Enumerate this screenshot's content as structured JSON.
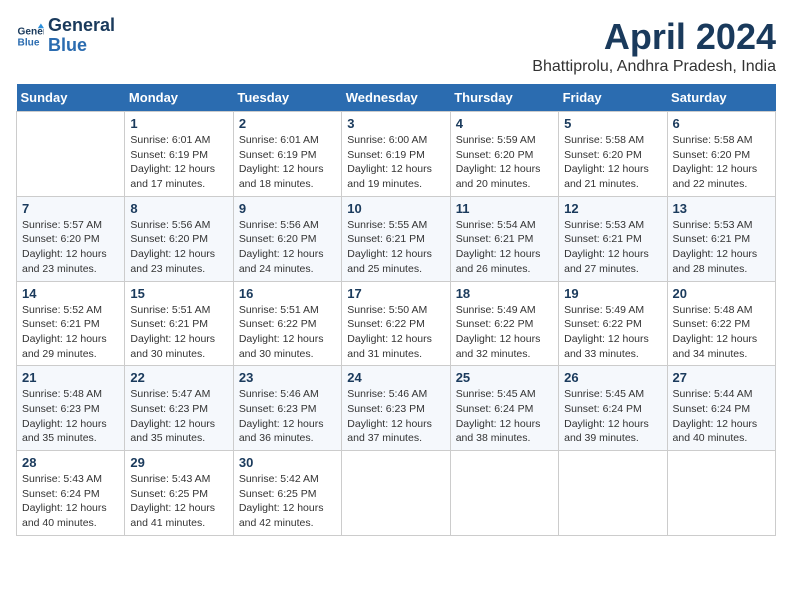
{
  "header": {
    "logo_line1": "General",
    "logo_line2": "Blue",
    "month": "April 2024",
    "location": "Bhattiprolu, Andhra Pradesh, India"
  },
  "days_of_week": [
    "Sunday",
    "Monday",
    "Tuesday",
    "Wednesday",
    "Thursday",
    "Friday",
    "Saturday"
  ],
  "weeks": [
    [
      {
        "day": "",
        "info": ""
      },
      {
        "day": "1",
        "info": "Sunrise: 6:01 AM\nSunset: 6:19 PM\nDaylight: 12 hours\nand 17 minutes."
      },
      {
        "day": "2",
        "info": "Sunrise: 6:01 AM\nSunset: 6:19 PM\nDaylight: 12 hours\nand 18 minutes."
      },
      {
        "day": "3",
        "info": "Sunrise: 6:00 AM\nSunset: 6:19 PM\nDaylight: 12 hours\nand 19 minutes."
      },
      {
        "day": "4",
        "info": "Sunrise: 5:59 AM\nSunset: 6:20 PM\nDaylight: 12 hours\nand 20 minutes."
      },
      {
        "day": "5",
        "info": "Sunrise: 5:58 AM\nSunset: 6:20 PM\nDaylight: 12 hours\nand 21 minutes."
      },
      {
        "day": "6",
        "info": "Sunrise: 5:58 AM\nSunset: 6:20 PM\nDaylight: 12 hours\nand 22 minutes."
      }
    ],
    [
      {
        "day": "7",
        "info": "Sunrise: 5:57 AM\nSunset: 6:20 PM\nDaylight: 12 hours\nand 23 minutes."
      },
      {
        "day": "8",
        "info": "Sunrise: 5:56 AM\nSunset: 6:20 PM\nDaylight: 12 hours\nand 23 minutes."
      },
      {
        "day": "9",
        "info": "Sunrise: 5:56 AM\nSunset: 6:20 PM\nDaylight: 12 hours\nand 24 minutes."
      },
      {
        "day": "10",
        "info": "Sunrise: 5:55 AM\nSunset: 6:21 PM\nDaylight: 12 hours\nand 25 minutes."
      },
      {
        "day": "11",
        "info": "Sunrise: 5:54 AM\nSunset: 6:21 PM\nDaylight: 12 hours\nand 26 minutes."
      },
      {
        "day": "12",
        "info": "Sunrise: 5:53 AM\nSunset: 6:21 PM\nDaylight: 12 hours\nand 27 minutes."
      },
      {
        "day": "13",
        "info": "Sunrise: 5:53 AM\nSunset: 6:21 PM\nDaylight: 12 hours\nand 28 minutes."
      }
    ],
    [
      {
        "day": "14",
        "info": "Sunrise: 5:52 AM\nSunset: 6:21 PM\nDaylight: 12 hours\nand 29 minutes."
      },
      {
        "day": "15",
        "info": "Sunrise: 5:51 AM\nSunset: 6:21 PM\nDaylight: 12 hours\nand 30 minutes."
      },
      {
        "day": "16",
        "info": "Sunrise: 5:51 AM\nSunset: 6:22 PM\nDaylight: 12 hours\nand 30 minutes."
      },
      {
        "day": "17",
        "info": "Sunrise: 5:50 AM\nSunset: 6:22 PM\nDaylight: 12 hours\nand 31 minutes."
      },
      {
        "day": "18",
        "info": "Sunrise: 5:49 AM\nSunset: 6:22 PM\nDaylight: 12 hours\nand 32 minutes."
      },
      {
        "day": "19",
        "info": "Sunrise: 5:49 AM\nSunset: 6:22 PM\nDaylight: 12 hours\nand 33 minutes."
      },
      {
        "day": "20",
        "info": "Sunrise: 5:48 AM\nSunset: 6:22 PM\nDaylight: 12 hours\nand 34 minutes."
      }
    ],
    [
      {
        "day": "21",
        "info": "Sunrise: 5:48 AM\nSunset: 6:23 PM\nDaylight: 12 hours\nand 35 minutes."
      },
      {
        "day": "22",
        "info": "Sunrise: 5:47 AM\nSunset: 6:23 PM\nDaylight: 12 hours\nand 35 minutes."
      },
      {
        "day": "23",
        "info": "Sunrise: 5:46 AM\nSunset: 6:23 PM\nDaylight: 12 hours\nand 36 minutes."
      },
      {
        "day": "24",
        "info": "Sunrise: 5:46 AM\nSunset: 6:23 PM\nDaylight: 12 hours\nand 37 minutes."
      },
      {
        "day": "25",
        "info": "Sunrise: 5:45 AM\nSunset: 6:24 PM\nDaylight: 12 hours\nand 38 minutes."
      },
      {
        "day": "26",
        "info": "Sunrise: 5:45 AM\nSunset: 6:24 PM\nDaylight: 12 hours\nand 39 minutes."
      },
      {
        "day": "27",
        "info": "Sunrise: 5:44 AM\nSunset: 6:24 PM\nDaylight: 12 hours\nand 40 minutes."
      }
    ],
    [
      {
        "day": "28",
        "info": "Sunrise: 5:43 AM\nSunset: 6:24 PM\nDaylight: 12 hours\nand 40 minutes."
      },
      {
        "day": "29",
        "info": "Sunrise: 5:43 AM\nSunset: 6:25 PM\nDaylight: 12 hours\nand 41 minutes."
      },
      {
        "day": "30",
        "info": "Sunrise: 5:42 AM\nSunset: 6:25 PM\nDaylight: 12 hours\nand 42 minutes."
      },
      {
        "day": "",
        "info": ""
      },
      {
        "day": "",
        "info": ""
      },
      {
        "day": "",
        "info": ""
      },
      {
        "day": "",
        "info": ""
      }
    ]
  ]
}
